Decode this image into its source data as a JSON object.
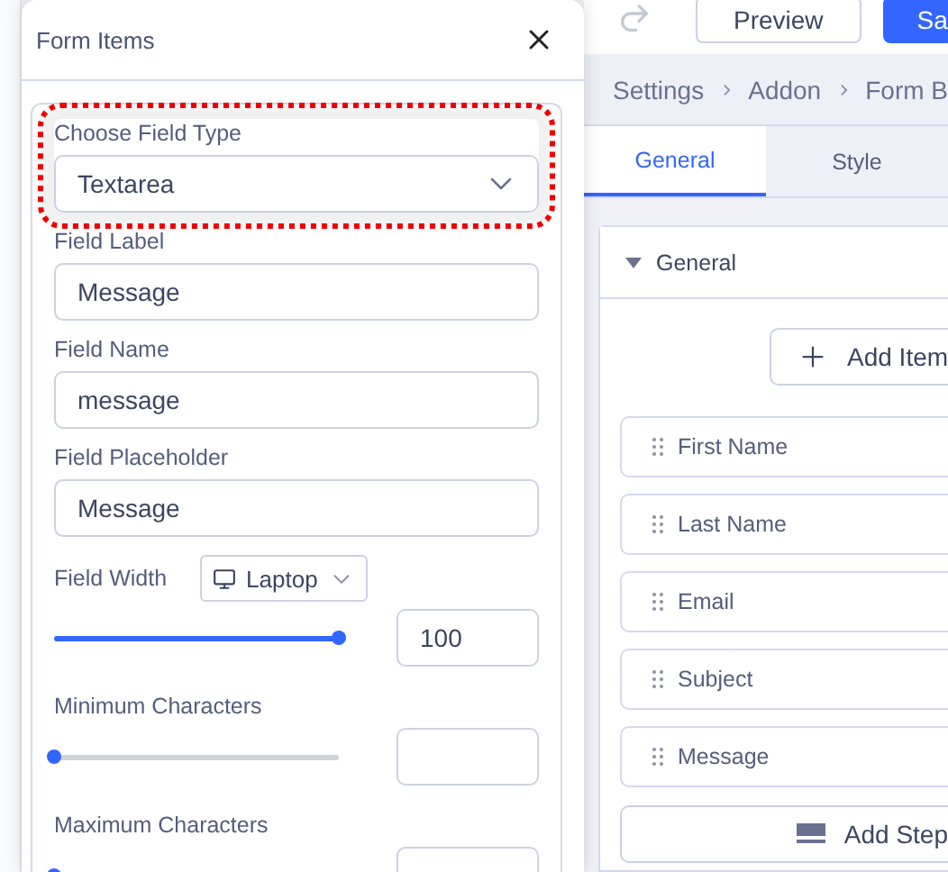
{
  "dialog": {
    "title": "Form Items",
    "fields": [
      {
        "kind": "select",
        "label": "Choose Field Type",
        "value": "Textarea",
        "highlighted": true
      },
      {
        "kind": "text",
        "label": "Field Label",
        "value": "Message"
      },
      {
        "kind": "text",
        "label": "Field Name",
        "value": "message"
      },
      {
        "kind": "text",
        "label": "Field Placeholder",
        "value": "Message"
      },
      {
        "kind": "responsive_slider",
        "label": "Field Width",
        "device": "Laptop",
        "level": 1,
        "value": "100"
      },
      {
        "kind": "slider",
        "label": "Minimum Characters",
        "level": 0
      },
      {
        "kind": "slider",
        "label": "Maximum Characters",
        "level": 0
      }
    ]
  },
  "toolbar": {
    "buttons": [
      {
        "label": "Preview",
        "kind": "outline"
      },
      {
        "label": "Sa",
        "kind": "primary"
      }
    ]
  },
  "breadcrumb": [
    "Settings",
    "Addon",
    "Form B"
  ],
  "tabs": [
    {
      "label": "General",
      "selected": true
    },
    {
      "label": "Style",
      "selected": false
    }
  ],
  "panel": {
    "title": "General",
    "expanded": true,
    "add_item": "Add Item",
    "items": [
      "First Name",
      "Last Name",
      "Email",
      "Subject",
      "Message"
    ],
    "add_step": "Add Step"
  }
}
